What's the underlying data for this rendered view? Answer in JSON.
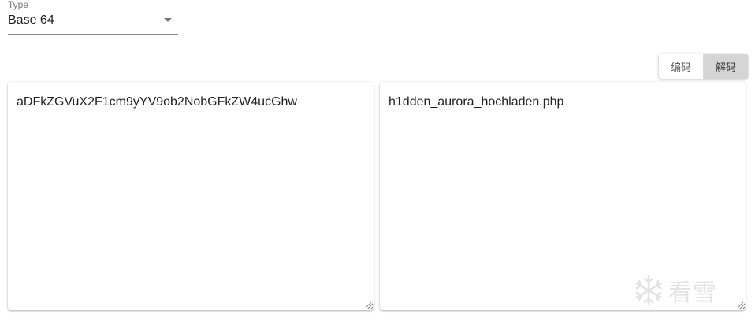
{
  "type_select": {
    "label": "Type",
    "value": "Base 64"
  },
  "mode_toggle": {
    "encode_label": "编码",
    "decode_label": "解码",
    "active": "decode"
  },
  "input_panel": {
    "value": "aDFkZGVuX2F1cm9yYV9ob2NobGFkZW4ucGhw"
  },
  "output_panel": {
    "value": "h1dden_aurora_hochladen.php"
  },
  "watermark": {
    "text": "看雪",
    "icon": "snowflake-icon"
  }
}
